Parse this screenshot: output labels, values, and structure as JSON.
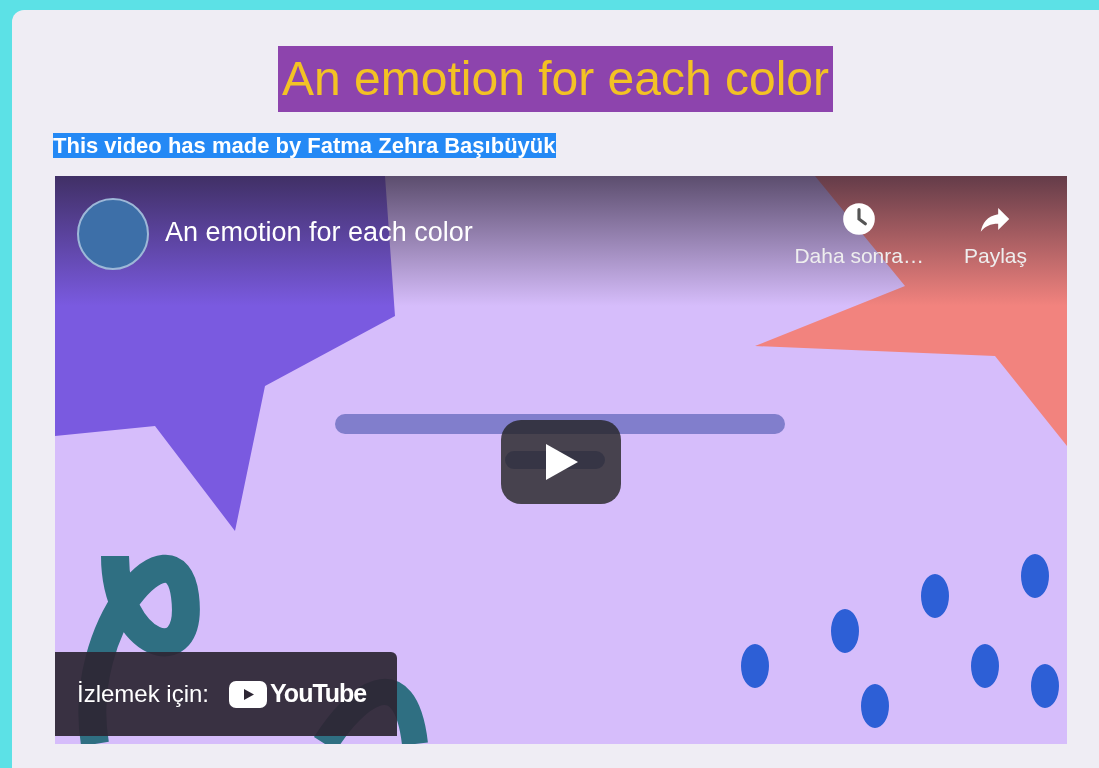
{
  "page": {
    "title": "An emotion for each color",
    "subtitle": "This video has made by Fatma Zehra Başıbüyük"
  },
  "video": {
    "kind": "picture",
    "title": "An emotion for each color",
    "actions": [
      {
        "kind": "clock",
        "label": "Daha sonra…"
      },
      {
        "kind": "share",
        "label": "Paylaş"
      }
    ],
    "watch_on": {
      "label": "İzlemek için:",
      "logo_text": "YouTube"
    }
  }
}
